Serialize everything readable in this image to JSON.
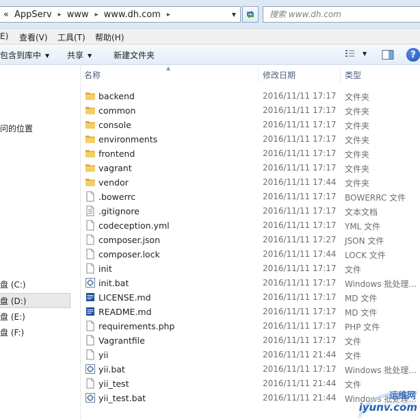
{
  "address_bar": {
    "overflow_glyph": "«",
    "crumbs": [
      "AppServ",
      "www",
      "www.dh.com"
    ],
    "separator": "▸",
    "dropdown_glyph": "▼"
  },
  "search": {
    "placeholder": "搜索 www.dh.com"
  },
  "menu": {
    "items": [
      "E)",
      "查看(V)",
      "工具(T)",
      "帮助(H)"
    ]
  },
  "toolbar": {
    "include_library": "包含到库中",
    "share": "共享",
    "new_folder": "新建文件夹",
    "help": "?"
  },
  "nav": {
    "location_label": "问的位置",
    "drives": [
      {
        "label": "盘 (C:)",
        "selected": false
      },
      {
        "label": "盘 (D:)",
        "selected": true
      },
      {
        "label": "盘 (E:)",
        "selected": false
      },
      {
        "label": "盘 (F:)",
        "selected": false
      }
    ]
  },
  "columns": {
    "name": "名称",
    "date": "修改日期",
    "type": "类型"
  },
  "files": [
    {
      "name": "backend",
      "date": "2016/11/11 17:17",
      "type": "文件夹",
      "icon": "folder"
    },
    {
      "name": "common",
      "date": "2016/11/11 17:17",
      "type": "文件夹",
      "icon": "folder"
    },
    {
      "name": "console",
      "date": "2016/11/11 17:17",
      "type": "文件夹",
      "icon": "folder"
    },
    {
      "name": "environments",
      "date": "2016/11/11 17:17",
      "type": "文件夹",
      "icon": "folder"
    },
    {
      "name": "frontend",
      "date": "2016/11/11 17:17",
      "type": "文件夹",
      "icon": "folder"
    },
    {
      "name": "vagrant",
      "date": "2016/11/11 17:17",
      "type": "文件夹",
      "icon": "folder"
    },
    {
      "name": "vendor",
      "date": "2016/11/11 17:44",
      "type": "文件夹",
      "icon": "folder"
    },
    {
      "name": ".bowerrc",
      "date": "2016/11/11 17:17",
      "type": "BOWERRC 文件",
      "icon": "file"
    },
    {
      "name": ".gitignore",
      "date": "2016/11/11 17:17",
      "type": "文本文档",
      "icon": "text"
    },
    {
      "name": "codeception.yml",
      "date": "2016/11/11 17:17",
      "type": "YML 文件",
      "icon": "file"
    },
    {
      "name": "composer.json",
      "date": "2016/11/11 17:27",
      "type": "JSON 文件",
      "icon": "file"
    },
    {
      "name": "composer.lock",
      "date": "2016/11/11 17:44",
      "type": "LOCK 文件",
      "icon": "file"
    },
    {
      "name": "init",
      "date": "2016/11/11 17:17",
      "type": "文件",
      "icon": "file"
    },
    {
      "name": "init.bat",
      "date": "2016/11/11 17:17",
      "type": "Windows 批处理...",
      "icon": "bat"
    },
    {
      "name": "LICENSE.md",
      "date": "2016/11/11 17:17",
      "type": "MD 文件",
      "icon": "md"
    },
    {
      "name": "README.md",
      "date": "2016/11/11 17:17",
      "type": "MD 文件",
      "icon": "md"
    },
    {
      "name": "requirements.php",
      "date": "2016/11/11 17:17",
      "type": "PHP 文件",
      "icon": "file"
    },
    {
      "name": "Vagrantfile",
      "date": "2016/11/11 17:17",
      "type": "文件",
      "icon": "file"
    },
    {
      "name": "yii",
      "date": "2016/11/11 21:44",
      "type": "文件",
      "icon": "file"
    },
    {
      "name": "yii.bat",
      "date": "2016/11/11 17:17",
      "type": "Windows 批处理...",
      "icon": "bat"
    },
    {
      "name": "yii_test",
      "date": "2016/11/11 21:44",
      "type": "文件",
      "icon": "file"
    },
    {
      "name": "yii_test.bat",
      "date": "2016/11/11 21:44",
      "type": "Windows 批处理...",
      "icon": "bat"
    }
  ],
  "watermark": {
    "line1": "运维网",
    "line2": "iyunv.com"
  },
  "colors": {
    "folder": "#e8b84a",
    "accent": "#1d4fb4",
    "header_text": "#4c607a"
  }
}
